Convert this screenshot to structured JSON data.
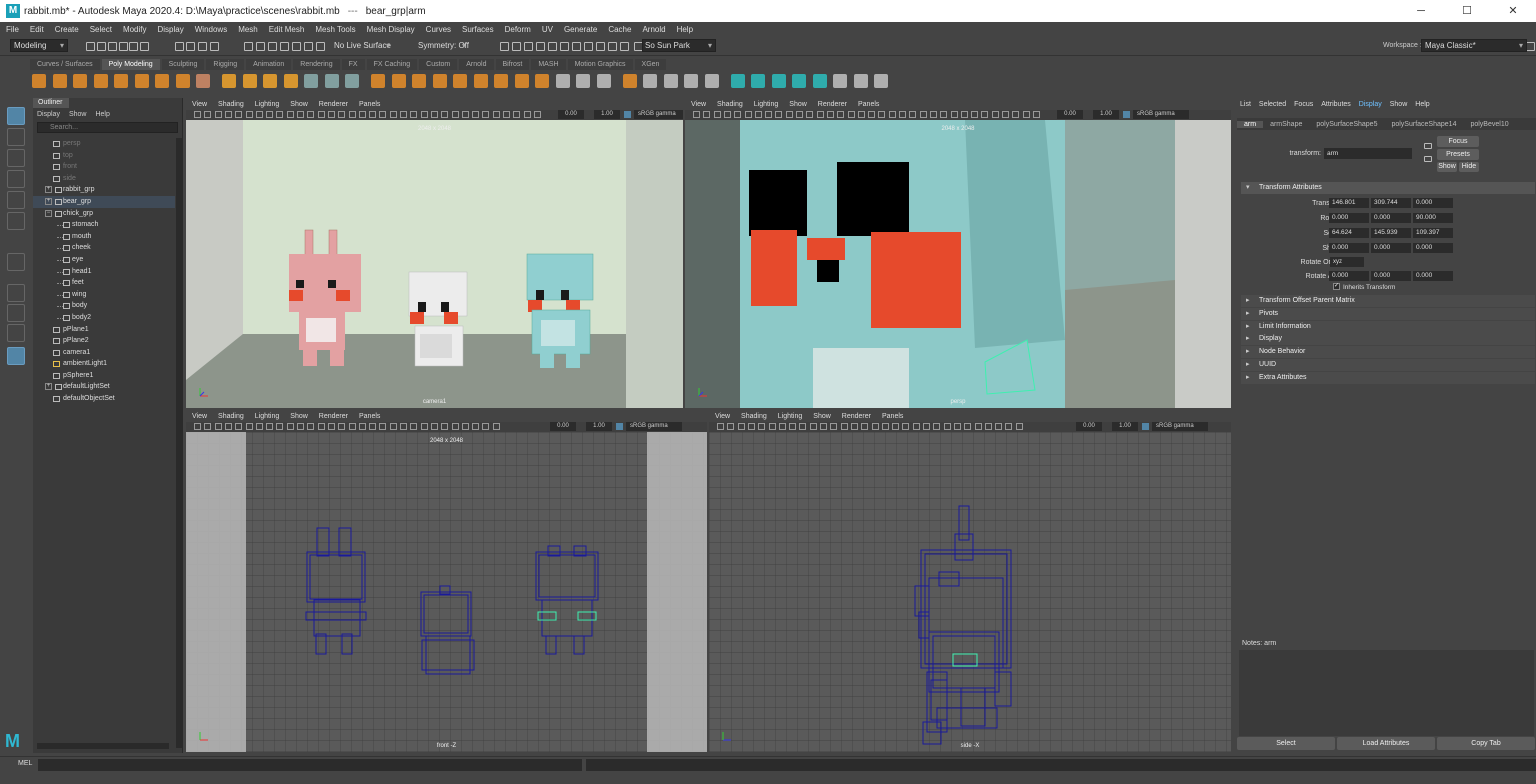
{
  "window": {
    "title": "rabbit.mb* - Autodesk Maya 2020.4: D:\\Maya\\practice\\scenes\\rabbit.mb",
    "separator": "---",
    "selection": "bear_grp|arm",
    "app_letter": "M",
    "minimize": "─",
    "maximize": "☐",
    "close": "✕"
  },
  "menus": [
    "File",
    "Edit",
    "Create",
    "Select",
    "Modify",
    "Display",
    "Windows",
    "Mesh",
    "Edit Mesh",
    "Mesh Tools",
    "Mesh Display",
    "Curves",
    "Surfaces",
    "Deform",
    "UV",
    "Generate",
    "Cache",
    "Arnold",
    "Help"
  ],
  "status": {
    "menuset": "Modeling",
    "live_surface": "No Live Surface",
    "symmetry": "Symmetry: Off",
    "user": "So Sun Park",
    "workspace_label": "Workspace :",
    "workspace": "Maya Classic*"
  },
  "shelf_tabs": [
    "Curves / Surfaces",
    "Poly Modeling",
    "Sculpting",
    "Rigging",
    "Animation",
    "Rendering",
    "FX",
    "FX Caching",
    "Custom",
    "Arnold",
    "Bifrost",
    "MASH",
    "Motion Graphics",
    "XGen"
  ],
  "shelf_active": "Poly Modeling",
  "outliner": {
    "title": "Outliner",
    "menus": [
      "Display",
      "Show",
      "Help"
    ],
    "search": "Search...",
    "items": [
      {
        "label": "persp",
        "indent": 1,
        "dim": true
      },
      {
        "label": "top",
        "indent": 1,
        "dim": true
      },
      {
        "label": "front",
        "indent": 1,
        "dim": true
      },
      {
        "label": "side",
        "indent": 1,
        "dim": true
      },
      {
        "label": "rabbit_grp",
        "indent": 0,
        "expand": "+"
      },
      {
        "label": "bear_grp",
        "indent": 0,
        "expand": "+",
        "selected": true
      },
      {
        "label": "chick_grp",
        "indent": 0,
        "expand": "−"
      },
      {
        "label": "stomach",
        "indent": 2
      },
      {
        "label": "mouth",
        "indent": 2
      },
      {
        "label": "cheek",
        "indent": 2
      },
      {
        "label": "eye",
        "indent": 2
      },
      {
        "label": "head1",
        "indent": 2
      },
      {
        "label": "feet",
        "indent": 2
      },
      {
        "label": "wing",
        "indent": 2
      },
      {
        "label": "body",
        "indent": 2
      },
      {
        "label": "body2",
        "indent": 2
      },
      {
        "label": "pPlane1",
        "indent": 1
      },
      {
        "label": "pPlane2",
        "indent": 1
      },
      {
        "label": "camera1",
        "indent": 1
      },
      {
        "label": "ambientLight1",
        "indent": 1
      },
      {
        "label": "pSphere1",
        "indent": 1
      },
      {
        "label": "defaultLightSet",
        "indent": 0,
        "expand": "+"
      },
      {
        "label": "defaultObjectSet",
        "indent": 1
      }
    ]
  },
  "viewport_menus": [
    "View",
    "Shading",
    "Lighting",
    "Show",
    "Renderer",
    "Panels"
  ],
  "viewport_toolbar": {
    "exposure": "0.00",
    "gamma": "1.00",
    "colorspace": "sRGB gamma"
  },
  "viewports": [
    {
      "id": "camera1",
      "label": "camera1",
      "res": "2048 x 2048"
    },
    {
      "id": "persp",
      "label": "persp",
      "res": "2048 x 2048"
    },
    {
      "id": "front",
      "label": "front -Z",
      "res": "2048 x 2048"
    },
    {
      "id": "side",
      "label": "side -X",
      "res": ""
    }
  ],
  "attr_editor": {
    "menus": [
      "List",
      "Selected",
      "Focus",
      "Attributes",
      "Display",
      "Show",
      "Help"
    ],
    "active_menu": "Display",
    "node_tabs": [
      "arm",
      "armShape",
      "polySurfaceShape5",
      "polySurfaceShape14",
      "polyBevel10"
    ],
    "transform_label": "transform:",
    "transform_value": "arm",
    "focus": "Focus",
    "presets": "Presets",
    "show": "Show",
    "hide": "Hide",
    "section": "Transform Attributes",
    "rows": [
      {
        "label": "Translate",
        "v": [
          "146.801",
          "309.744",
          "0.000"
        ]
      },
      {
        "label": "Rotate",
        "v": [
          "0.000",
          "0.000",
          "90.000"
        ]
      },
      {
        "label": "Scale",
        "v": [
          "64.624",
          "145.939",
          "109.397"
        ]
      },
      {
        "label": "Shear",
        "v": [
          "0.000",
          "0.000",
          "0.000"
        ]
      }
    ],
    "rotate_order_label": "Rotate Order",
    "rotate_order": "xyz",
    "rotate_axis": {
      "label": "Rotate Axis",
      "v": [
        "0.000",
        "0.000",
        "0.000"
      ]
    },
    "inherits": "Inherits Transform",
    "sections": [
      "Transform Offset Parent Matrix",
      "Pivots",
      "Limit Information",
      "Display",
      "Node Behavior",
      "UUID",
      "Extra Attributes"
    ],
    "notes": "Notes:  arm",
    "buttons": [
      "Select",
      "Load Attributes",
      "Copy Tab"
    ]
  },
  "cmd": {
    "lang": "MEL"
  },
  "colors": {
    "select_blue": "#5285a6",
    "wire": "#1a1a9a",
    "active_green": "#3ef0b0",
    "rabbit": "#e3a1a2",
    "bear": "#90cfd0",
    "chick": "#ececec",
    "cheek": "#e64a2c"
  }
}
